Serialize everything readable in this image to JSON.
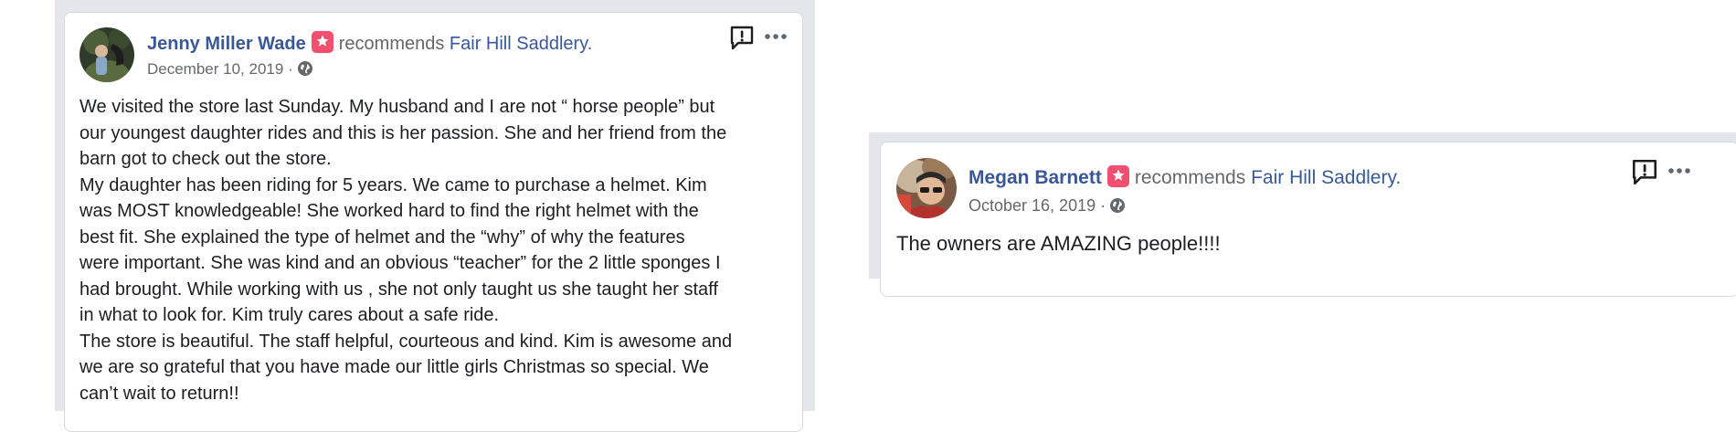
{
  "posts": [
    {
      "author": "Jenny Miller Wade",
      "verb": "recommends",
      "place": "Fair Hill Saddlery.",
      "date": "December 10, 2019",
      "separator": "·",
      "body": "We visited the store last Sunday. My husband and I are not “ horse people” but\nour youngest daughter rides and this is her passion. She and her friend from the\nbarn got to check out the store.\nMy daughter has been riding for 5 years. We came to purchase a helmet. Kim\nwas MOST knowledgeable! She worked hard to find the right helmet with the\nbest fit. She explained the type of helmet and the “why” of why the features\nwere important. She was kind and an obvious “teacher” for the 2 little sponges I\nhad brought. While working with us , she not only taught us she taught her staff\nin what to look for. Kim truly cares about a safe ride.\nThe store is beautiful. The staff helpful, courteous and kind. Kim is awesome and\nwe are so grateful that you have made our little girls Christmas so special. We\ncan’t wait to return!!"
    },
    {
      "author": "Megan Barnett",
      "verb": "recommends",
      "place": "Fair Hill Saddlery.",
      "date": "October 16, 2019",
      "separator": "·",
      "body": "The owners are AMAZING people!!!!"
    }
  ],
  "icons": {
    "badge": "recommendation-star-icon",
    "globe": "public-globe-icon",
    "report": "report-icon",
    "more": "more-options-icon"
  },
  "colors": {
    "link": "#385898",
    "muted": "#65676b",
    "text": "#1c1e21",
    "badge": "#f0506e",
    "panel": "#e4e6eb"
  }
}
